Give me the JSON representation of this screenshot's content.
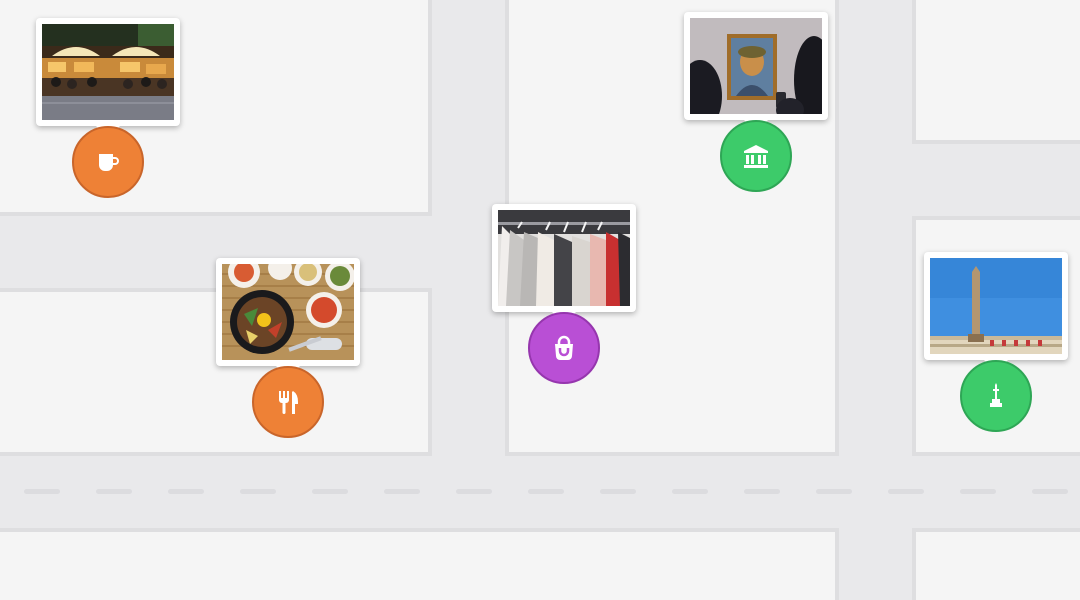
{
  "colors": {
    "background": "#e9e9eb",
    "block_fill": "#f5f5f5",
    "block_border": "#dedee0",
    "road_dash": "#dcdcdf",
    "food_pin": "#ee8136",
    "culture_pin": "#3dcb6a",
    "shopping_pin": "#b94fd5",
    "card": "#ffffff"
  },
  "map": {
    "markers": [
      {
        "id": "cafe",
        "category": "food",
        "icon": "coffee-cup-icon",
        "photo": "street-cafe-terrace-photo"
      },
      {
        "id": "museum",
        "category": "culture",
        "icon": "museum-building-icon",
        "photo": "museum-painting-photo"
      },
      {
        "id": "restaurant",
        "category": "food",
        "icon": "fork-knife-icon",
        "photo": "korean-bibimbap-meal-photo"
      },
      {
        "id": "shop",
        "category": "shopping",
        "icon": "shopping-bag-icon",
        "photo": "clothing-rack-photo"
      },
      {
        "id": "monument",
        "category": "culture",
        "icon": "monument-icon",
        "photo": "obelisk-monument-photo"
      }
    ]
  }
}
